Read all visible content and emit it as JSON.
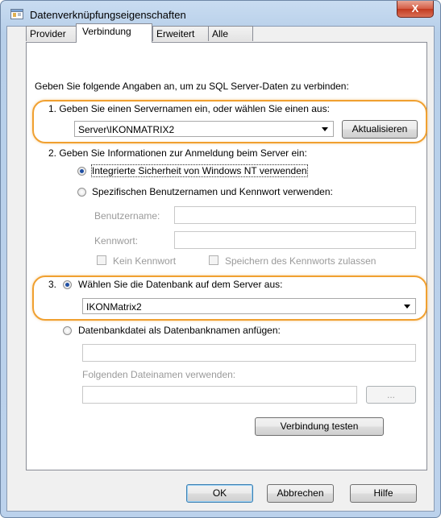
{
  "window": {
    "title": "Datenverknüpfungseigenschaften",
    "close_label": "X"
  },
  "tabs": [
    {
      "label": "Provider",
      "active": false
    },
    {
      "label": "Verbindung",
      "active": true
    },
    {
      "label": "Erweitert",
      "active": false
    },
    {
      "label": "Alle",
      "active": false
    }
  ],
  "form": {
    "intro": "Geben Sie folgende Angaben an, um zu SQL Server-Daten zu verbinden:",
    "step1_label": "1. Geben Sie einen Servernamen ein, oder wählen Sie einen aus:",
    "server_value": "Server\\IKONMATRIX2",
    "refresh_label": "Aktualisieren",
    "step2_label": "2. Geben Sie Informationen zur Anmeldung beim Server ein:",
    "auth_windows_label": "Integrierte Sicherheit von Windows NT verwenden",
    "auth_user_label": "Spezifischen Benutzernamen und Kennwort verwenden:",
    "username_label": "Benutzername:",
    "password_label": "Kennwort:",
    "no_password_label": "Kein Kennwort",
    "save_password_label": "Speichern des Kennworts zulassen",
    "step3_prefix": "3.",
    "select_db_label": "Wählen Sie die Datenbank auf dem Server aus:",
    "database_value": "IKONMatrix2",
    "attach_db_label": "Datenbankdatei als Datenbanknamen anfügen:",
    "filename_label": "Folgenden Dateinamen verwenden:",
    "browse_label": "...",
    "test_label": "Verbindung testen"
  },
  "buttons": {
    "ok": "OK",
    "cancel": "Abbrechen",
    "help": "Hilfe"
  },
  "colors": {
    "highlight": "#f0a030",
    "titlebar": "#c9dcf1",
    "close": "#c23a1f"
  }
}
